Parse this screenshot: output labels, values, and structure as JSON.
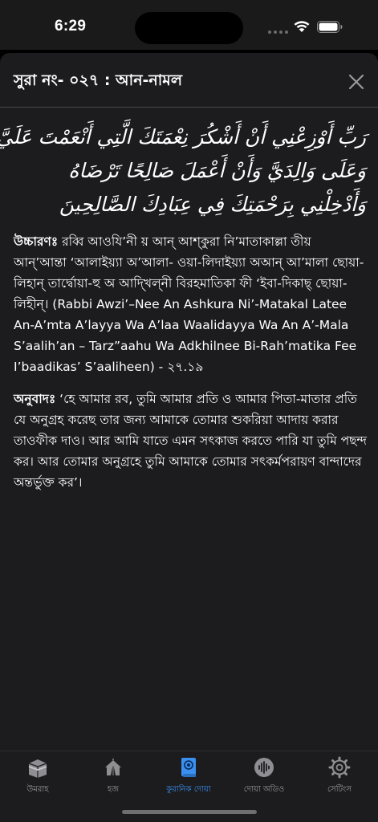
{
  "status_bar": {
    "time": "6:29"
  },
  "sheet": {
    "title": "সুরা নং- ০২৭ : আন-নামল",
    "arabic_lines": [
      "رَبِّ أَوْزِعْنِي أَنْ أَشْكُرَ نِعْمَتَكَ الَّتِي أَنْعَمْتَ عَلَيَّ",
      "وَعَلَى وَالِدَيَّ وَأَنْ أَعْمَلَ صَالِحًا تَرْضَاهُ",
      "وَأَدْخِلْنِي بِرَحْمَتِكَ فِي عِبَادِكَ الصَّالِحِينَ"
    ],
    "pronunciation_label": "উচ্চারণঃ",
    "pronunciation_text": " রব্বি আওযি’নী য় আন্ আশ্কুরা নি’মাতাকাল্লা তীয় আন্’আম্তা ‘আলাইয়্যা অ’আলা- ওয়া-লিদাইয়্যা অআন্ আ’মালা ছোয়া-লিহান্ তার্দ্বোয়া-হু অ আদ্খিল্নী বিরহমাতিকা ফী ‘ইবা-দিকাছ্ ছোয়া-লিহীন্। (Rabbi Awzi’–Nee An Ashkura Ni’-Matakal Latee An-A’mta A’layya Wa A’laa Waalidayya Wa An A’-Mala S’aalih’an – Tarz”aahu Wa Adkhilnee Bi-Rah’matika Fee I’baadikas’ S’aaliheen) - ২৭.১৯",
    "translation_label": "অনুবাদঃ",
    "translation_text": " ‘হে আমার রব, তুমি আমার প্রতি ও আমার পিতা-মাতার প্রতি যে অনুগ্রহ করেছ তার জন্য আমাকে তোমার শুকরিয়া আদায় করার তাওফীক দাও। আর আমি যাতে এমন সৎকাজ করতে পারি যা তুমি পছন্দ কর। আর তোমার অনুগ্রহে তুমি আমাকে তোমার সৎকর্মপরায়ণ বান্দাদের অন্তর্ভুক্ত কর’।"
  },
  "tabs": [
    {
      "label": "উমরাহ",
      "icon": "kaaba-icon",
      "active": false
    },
    {
      "label": "হজ",
      "icon": "tent-icon",
      "active": false
    },
    {
      "label": "কুরানিক দোয়া",
      "icon": "quran-book-icon",
      "active": true
    },
    {
      "label": "দোয়া অডিও",
      "icon": "audio-wave-icon",
      "active": false
    },
    {
      "label": "সেটিংস",
      "icon": "gear-icon",
      "active": false
    }
  ],
  "colors": {
    "accent": "#3a8ff0",
    "sheet_bg": "#1c1c1e",
    "inactive": "#9a9a9a"
  }
}
